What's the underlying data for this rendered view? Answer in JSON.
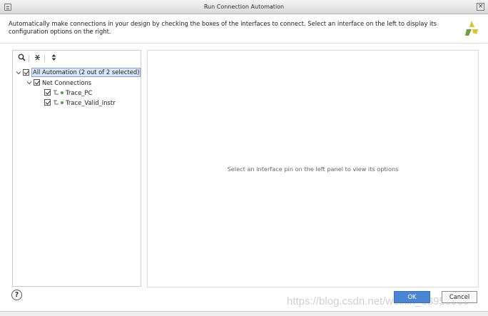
{
  "window": {
    "title": "Run Connection Automation"
  },
  "description": "Automatically make connections in your design by checking the boxes of the interfaces to connect. Select an interface on the left to display its configuration options on the right.",
  "tree": {
    "root": {
      "label": "All Automation (2 out of 2 selected)",
      "checked": true,
      "expanded": true,
      "selected": true
    },
    "group": {
      "label": "Net Connections",
      "checked": true,
      "expanded": true
    },
    "items": [
      {
        "label": "Trace_PC",
        "checked": true,
        "icon": "pin-icon",
        "status_color": "#4aa34a"
      },
      {
        "label": "Trace_Valid_Instr",
        "checked": true,
        "icon": "pin-icon",
        "status_color": "#4aa34a"
      }
    ]
  },
  "right_panel": {
    "message": "Select an interface pin on the left panel to view its options"
  },
  "buttons": {
    "ok": "OK",
    "cancel": "Cancel",
    "help": "?"
  },
  "watermark": "https://blog.csdn.net/weixin_38956966",
  "colors": {
    "accent": "#4a86d4",
    "logo_yellow": "#e3c229",
    "logo_green": "#6aa33a"
  }
}
